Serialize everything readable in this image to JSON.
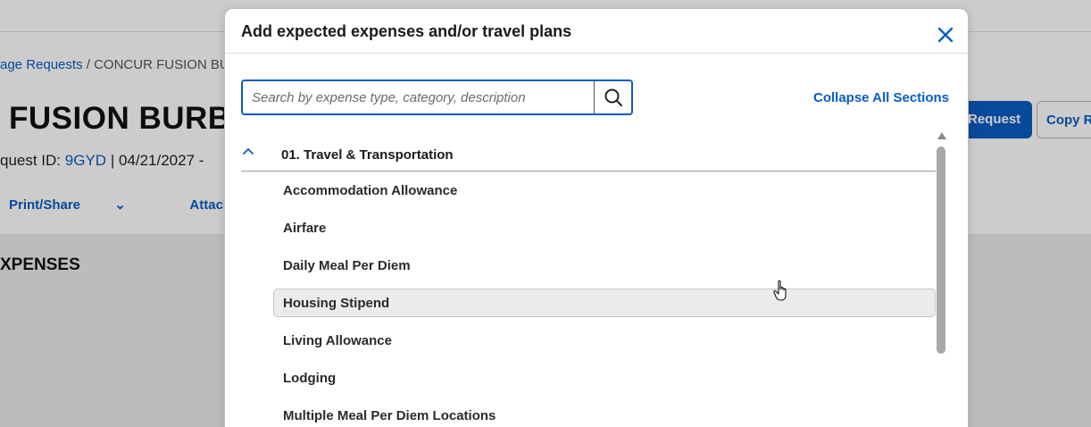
{
  "background": {
    "breadcrumb_link": "age Requests",
    "breadcrumb_sep": " / ",
    "breadcrumb_current": "CONCUR FUSION BU",
    "title": "FUSION BURB",
    "meta_label": "quest ID:",
    "request_id": "9GYD",
    "meta_rest": "|  04/21/2027 -",
    "actions": [
      "Print/Share",
      "Attachments"
    ],
    "expenses_heading": "XPENSES",
    "primary_button": "Request",
    "secondary_button": "Copy R"
  },
  "modal": {
    "title": "Add expected expenses and/or travel plans",
    "search": {
      "placeholder": "Search by expense type, category, description",
      "value": ""
    },
    "collapse_all_label": "Collapse All Sections",
    "section": {
      "title": "01. Travel & Transportation",
      "items": [
        "Accommodation Allowance",
        "Airfare",
        "Daily Meal Per Diem",
        "Housing Stipend",
        "Living Allowance",
        "Lodging",
        "Multiple Meal Per Diem Locations"
      ],
      "hovered_item": "Housing Stipend"
    }
  },
  "icons": {
    "close": "close-icon",
    "search": "search-icon",
    "chevron": "chevron-up-icon",
    "chevron_down": "chevron-down-icon",
    "cursor": "hand-cursor-icon"
  },
  "colors": {
    "accent": "#0a5cc2",
    "hover": "#ebebeb"
  }
}
